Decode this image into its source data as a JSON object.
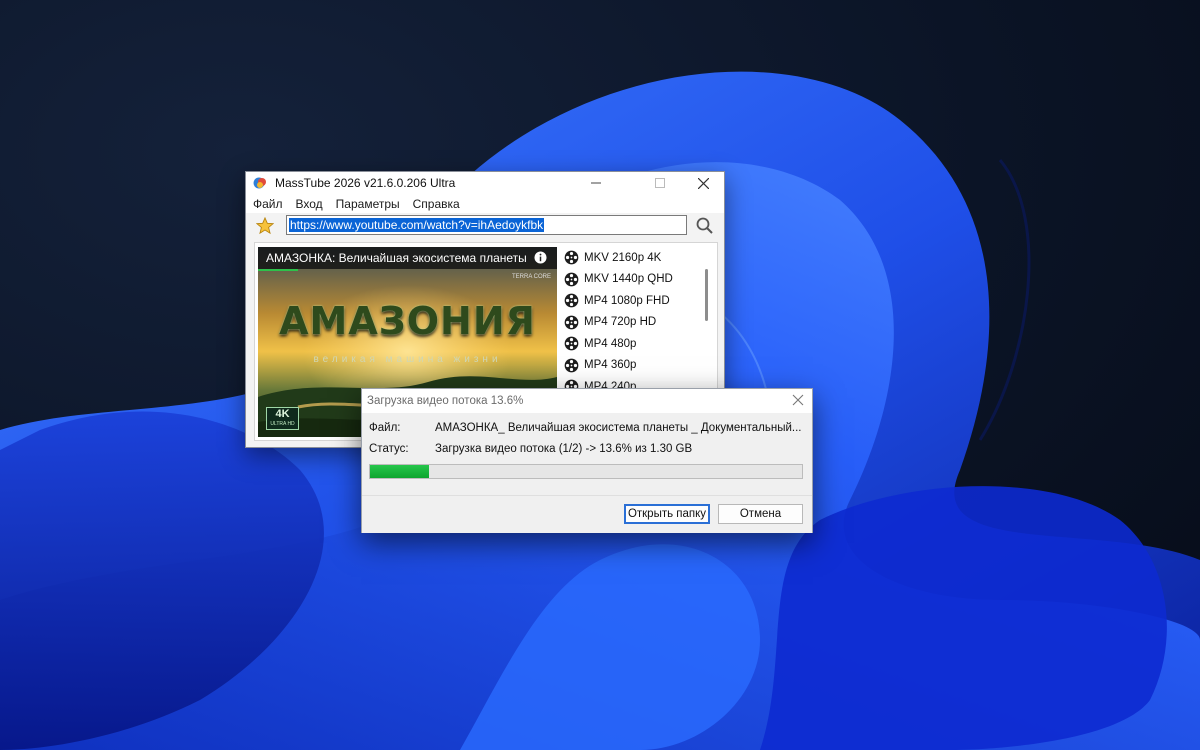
{
  "main_window": {
    "title": "MassTube 2026 v21.6.0.206 Ultra",
    "menu": [
      "Файл",
      "Вход",
      "Параметры",
      "Справка"
    ],
    "url": "https://www.youtube.com/watch?v=ihAedoykfbk",
    "video": {
      "title": "АМАЗОНКА: Величайшая экосистема планеты | ...",
      "channel_badge": "TERRA CORE",
      "art_title": "АМАЗОНИЯ",
      "art_subtitle": "великая машина жизни",
      "quality_badge": "4K",
      "quality_badge_sub": "ULTRA HD"
    },
    "formats": [
      "MKV 2160p 4K",
      "MKV 1440p QHD",
      "MP4 1080p FHD",
      "MP4 720p HD",
      "MP4 480p",
      "MP4 360p",
      "MP4 240p"
    ]
  },
  "download_dialog": {
    "title": "Загрузка видео потока 13.6%",
    "file_label": "Файл:",
    "file_value": "АМАЗОНКА_ Величайшая экосистема планеты _ Документальный...",
    "status_label": "Статус:",
    "status_value": "Загрузка видео потока (1/2) -> 13.6% из 1.30 GB",
    "progress": 0.136,
    "open_folder_label": "Открыть папку",
    "cancel_label": "Отмена"
  },
  "colors": {
    "accent": "#0a64d6",
    "progress": "#1db940",
    "wallpaper_blue": "#1f4fe8"
  }
}
